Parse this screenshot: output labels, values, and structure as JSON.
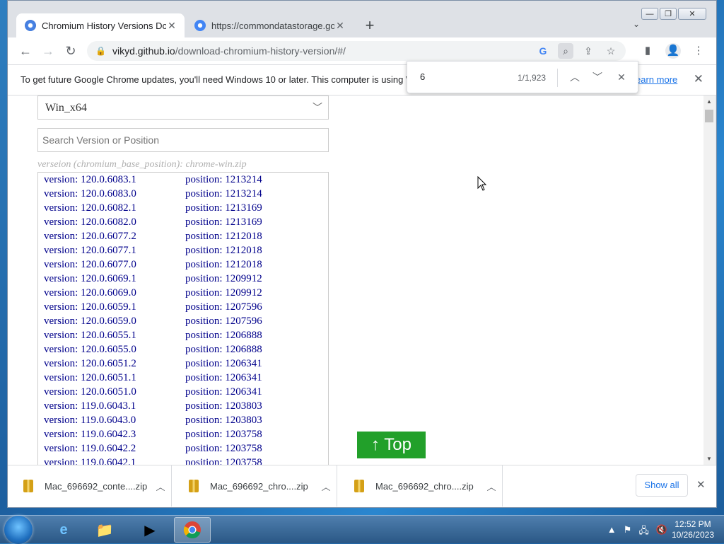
{
  "browser": {
    "tabs": [
      {
        "title": "Chromium History Versions Dow",
        "favicon": "chromium-icon",
        "active": true
      },
      {
        "title": "https://commondatastorage.goo",
        "favicon": "google-cloud-icon",
        "active": false
      }
    ],
    "new_tab_icon": "+",
    "tab_list_icon": "⌄",
    "window_controls": {
      "minimize": "—",
      "restore": "❐",
      "close": "✕"
    },
    "url_host": "vikyd.github.io",
    "url_rest": "/download-chromium-history-version/#/",
    "infobar": {
      "text": "To get future Google Chrome updates, you'll need Windows 10 or later. This computer is using W",
      "link": "earn more",
      "close": "✕"
    },
    "find": {
      "query": "6",
      "count": "1/1,923"
    }
  },
  "page": {
    "platform_select": "Win_x64",
    "search_placeholder": "Search Version or Position",
    "hint": "verseion (chromium_base_position): chrome-win.zip",
    "rows": [
      {
        "version": "version: 120.0.6083.1",
        "position": "position: 1213214"
      },
      {
        "version": "version: 120.0.6083.0",
        "position": "position: 1213214"
      },
      {
        "version": "version: 120.0.6082.1",
        "position": "position: 1213169"
      },
      {
        "version": "version: 120.0.6082.0",
        "position": "position: 1213169"
      },
      {
        "version": "version: 120.0.6077.2",
        "position": "position: 1212018"
      },
      {
        "version": "version: 120.0.6077.1",
        "position": "position: 1212018"
      },
      {
        "version": "version: 120.0.6077.0",
        "position": "position: 1212018"
      },
      {
        "version": "version: 120.0.6069.1",
        "position": "position: 1209912"
      },
      {
        "version": "version: 120.0.6069.0",
        "position": "position: 1209912"
      },
      {
        "version": "version: 120.0.6059.1",
        "position": "position: 1207596"
      },
      {
        "version": "version: 120.0.6059.0",
        "position": "position: 1207596"
      },
      {
        "version": "version: 120.0.6055.1",
        "position": "position: 1206888"
      },
      {
        "version": "version: 120.0.6055.0",
        "position": "position: 1206888"
      },
      {
        "version": "version: 120.0.6051.2",
        "position": "position: 1206341"
      },
      {
        "version": "version: 120.0.6051.1",
        "position": "position: 1206341"
      },
      {
        "version": "version: 120.0.6051.0",
        "position": "position: 1206341"
      },
      {
        "version": "version: 119.0.6043.1",
        "position": "position: 1203803"
      },
      {
        "version": "version: 119.0.6043.0",
        "position": "position: 1203803"
      },
      {
        "version": "version: 119.0.6042.3",
        "position": "position: 1203758"
      },
      {
        "version": "version: 119.0.6042.2",
        "position": "position: 1203758"
      },
      {
        "version": "version: 119.0.6042.1",
        "position": "position: 1203758"
      }
    ],
    "top_button": "↑ Top"
  },
  "downloads": {
    "items": [
      {
        "name": "Mac_696692_conte....zip"
      },
      {
        "name": "Mac_696692_chro....zip"
      },
      {
        "name": "Mac_696692_chro....zip"
      }
    ],
    "show_all": "Show all"
  },
  "taskbar": {
    "apps": [
      "internet-explorer-icon",
      "file-explorer-icon",
      "media-player-icon",
      "chrome-icon"
    ],
    "clock_time": "12:52 PM",
    "clock_date": "10/26/2023"
  },
  "colors": {
    "link_blue": "#00008b",
    "top_button_green": "#22a02a",
    "chrome_accent": "#1a73e8"
  }
}
